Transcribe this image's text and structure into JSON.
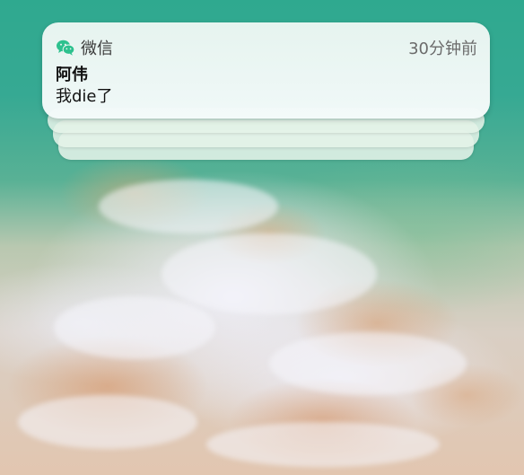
{
  "notification": {
    "app_name": "微信",
    "app_icon": "wechat-icon",
    "time": "30分钟前",
    "title": "阿伟",
    "message": "我die了",
    "stacked_count_visible": 3,
    "icon_color": "#2dc18e"
  }
}
